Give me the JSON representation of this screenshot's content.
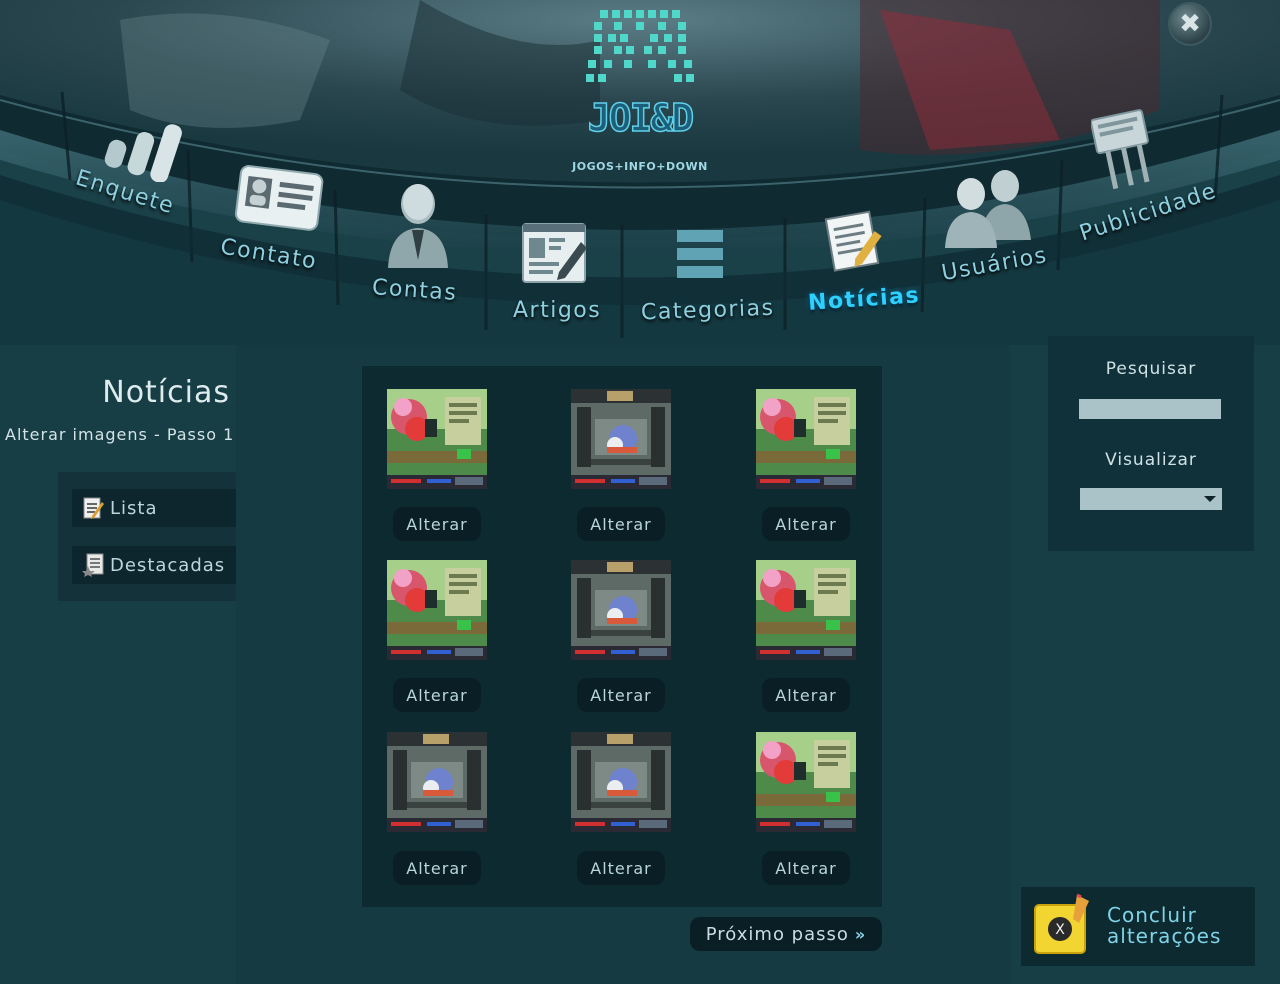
{
  "header": {
    "logo_text": "JOI&D",
    "logo_subtitle": "JOGOS+INFO+DOWN",
    "close_symbol": "✖"
  },
  "nav": {
    "items": [
      {
        "label": "Enquete",
        "icon": "bar-chart-icon"
      },
      {
        "label": "Contato",
        "icon": "id-card-icon"
      },
      {
        "label": "Contas",
        "icon": "user-icon"
      },
      {
        "label": "Artigos",
        "icon": "edit-document-icon"
      },
      {
        "label": "Categorias",
        "icon": "menu-bars-icon"
      },
      {
        "label": "Notícias",
        "icon": "notepad-pencil-icon",
        "active": true
      },
      {
        "label": "Usuários",
        "icon": "users-icon"
      },
      {
        "label": "Publicidade",
        "icon": "billboard-icon"
      }
    ],
    "active_color": "#2ed0ff"
  },
  "page": {
    "title": "Notícias",
    "subtitle": "Alterar imagens - Passo 1"
  },
  "sidebar": {
    "items": [
      {
        "label": "Lista",
        "icon": "notepad-icon"
      },
      {
        "label": "Destacadas",
        "icon": "star-document-icon"
      }
    ]
  },
  "gallery": {
    "button_label": "Alterar",
    "images": [
      {
        "style": "green-forest-game-screenshot"
      },
      {
        "style": "gray-dungeon-game-screenshot"
      },
      {
        "style": "green-forest-game-screenshot"
      },
      {
        "style": "green-forest-game-screenshot"
      },
      {
        "style": "gray-dungeon-game-screenshot"
      },
      {
        "style": "green-forest-game-screenshot"
      },
      {
        "style": "gray-dungeon-game-screenshot"
      },
      {
        "style": "gray-dungeon-game-screenshot"
      },
      {
        "style": "green-forest-game-screenshot"
      }
    ],
    "next_label": "Próximo passo",
    "next_arrow": "»"
  },
  "right_panel": {
    "search_label": "Pesquisar",
    "search_value": "",
    "view_label": "Visualizar",
    "view_value": "",
    "finish_line1": "Concluir",
    "finish_line2": "alterações",
    "finish_icon_letter": "X"
  },
  "colors": {
    "background": "#143840",
    "panel": "#0e2a31",
    "accent": "#2ed0ff",
    "text": "#cfe6ea"
  }
}
